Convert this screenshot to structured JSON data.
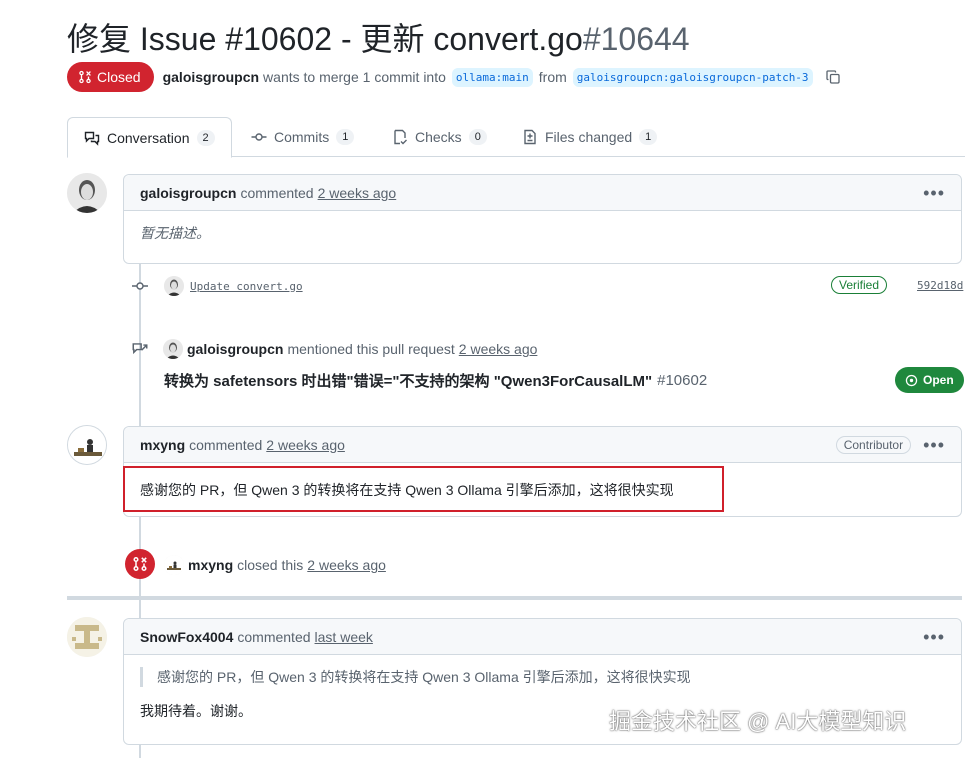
{
  "header": {
    "title": "修复 Issue #10602 - 更新 convert.go",
    "number": "#10644",
    "state": "Closed",
    "author": "galoisgroupcn",
    "merge_text": "wants to merge 1 commit into",
    "base_branch": "ollama:main",
    "from_text": "from",
    "head_branch": "galoisgroupcn:galoisgroupcn-patch-3"
  },
  "tabs": [
    {
      "label": "Conversation",
      "count": "2",
      "icon": "comment-discussion-icon"
    },
    {
      "label": "Commits",
      "count": "1",
      "icon": "git-commit-icon"
    },
    {
      "label": "Checks",
      "count": "0",
      "icon": "checklist-icon"
    },
    {
      "label": "Files changed",
      "count": "1",
      "icon": "file-diff-icon"
    }
  ],
  "timeline": {
    "comment1": {
      "author": "galoisgroupcn",
      "action": "commented",
      "time": "2 weeks ago",
      "body": "暂无描述。"
    },
    "commit": {
      "message": "Update convert.go",
      "badge": "Verified",
      "sha": "592d18d"
    },
    "mention": {
      "author": "galoisgroupcn",
      "action": "mentioned this pull request",
      "time": "2 weeks ago",
      "issue_title": "转换为 safetensors 时出错\"错误=\"不支持的架构 \"Qwen3ForCausalLM\"",
      "issue_number": "#10602",
      "issue_state": "Open"
    },
    "comment2": {
      "author": "mxyng",
      "action": "commented",
      "time": "2 weeks ago",
      "role": "Contributor",
      "body": "感谢您的 PR，但 Qwen 3 的转换将在支持 Qwen 3 Ollama 引擎后添加，这将很快实现"
    },
    "closed_event": {
      "author": "mxyng",
      "action": "closed this",
      "time": "2 weeks ago"
    },
    "comment3": {
      "author": "SnowFox4004",
      "action": "commented",
      "time": "last week",
      "quote": "感谢您的 PR，但 Qwen 3 的转换将在支持 Qwen 3 Ollama 引擎后添加，这将很快实现",
      "body": "我期待着。谢谢。"
    }
  },
  "watermark": "掘金技术社区 @ AI大模型知识",
  "colors": {
    "closed": "#d1242f",
    "open": "#1f883d",
    "link": "#0969da",
    "highlight": "#d0202b"
  }
}
